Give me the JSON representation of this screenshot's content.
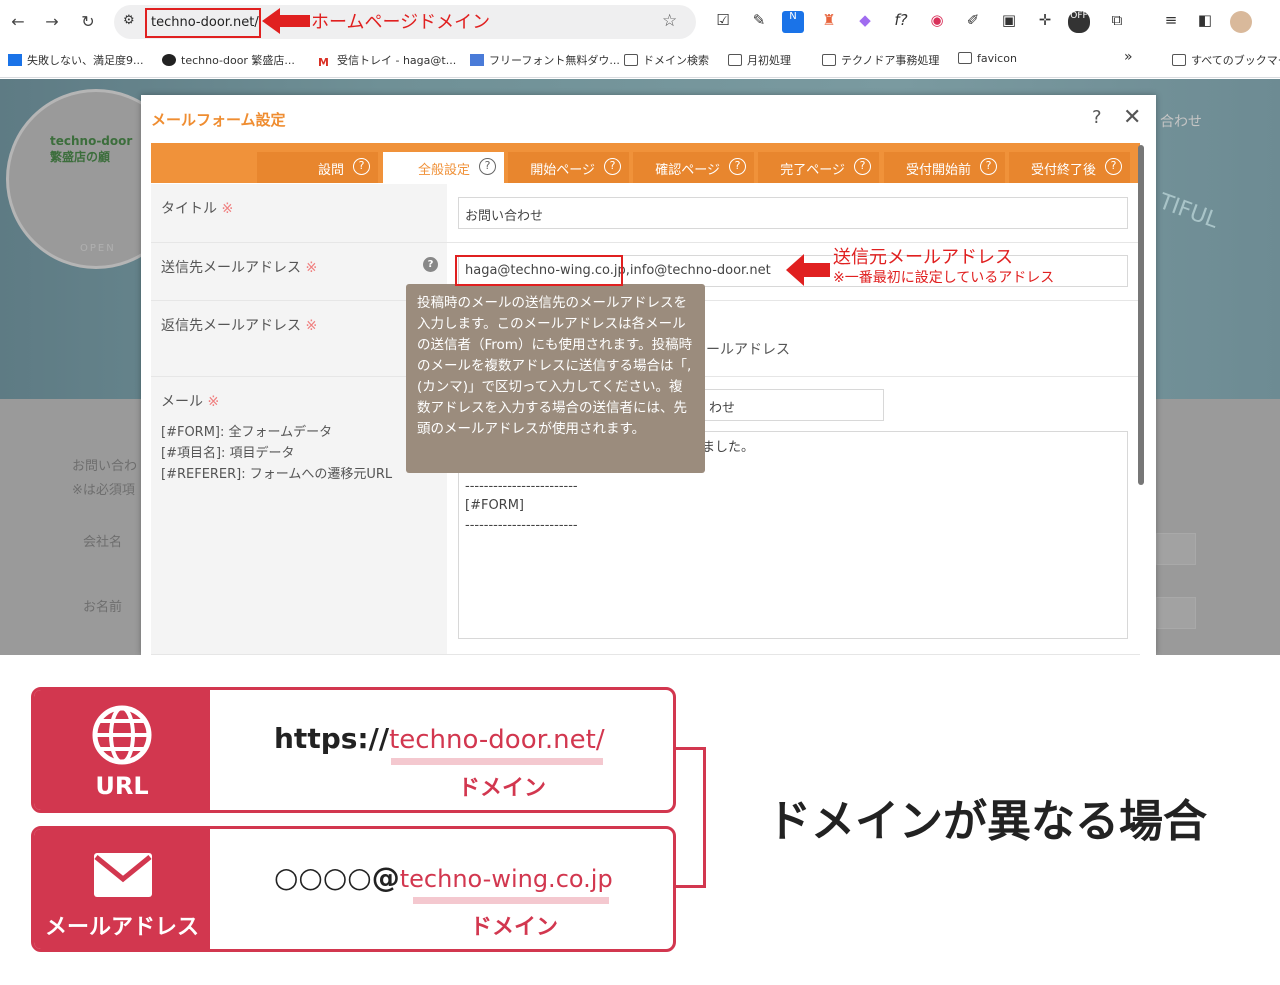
{
  "browser": {
    "url": "techno-door.net/co",
    "url_callout": "ホームページドメイン",
    "bookmarks": [
      "失敗しない、満足度9...",
      "techno-door 繁盛店...",
      "受信トレイ - haga@t...",
      "フリーフォント無料ダウ...",
      "ドメイン検索",
      "月初処理",
      "テクノドア事務処理",
      "favicon",
      "すべてのブックマーク"
    ],
    "more": "»"
  },
  "background": {
    "logo_line1": "techno-door",
    "logo_line2": "繁盛店の顧",
    "open_text": "OPEN",
    "contact_nav": "合わせ",
    "hero_text": "TIFUL",
    "form_intro": "お問い合わ",
    "required_note": "※は必須項",
    "company": "会社名",
    "name": "お名前"
  },
  "dialog": {
    "title": "メールフォーム設定",
    "help": "?",
    "close": "✕",
    "tabs": [
      {
        "label": "設問",
        "active": false
      },
      {
        "label": "全般設定",
        "active": true
      },
      {
        "label": "開始ページ",
        "active": false
      },
      {
        "label": "確認ページ",
        "active": false
      },
      {
        "label": "完了ページ",
        "active": false
      },
      {
        "label": "受付開始前",
        "active": false
      },
      {
        "label": "受付終了後",
        "active": false
      }
    ],
    "tab_q": "?",
    "rows": {
      "title_label": "タイトル",
      "title_value": "お問い合わせ",
      "sender_label": "送信先メールアドレス",
      "sender_value": "haga@techno-wing.co.jp,info@techno-door.net",
      "reply_label": "返信先メールアドレス",
      "reply_partial": "ールアドレス",
      "mail_label": "メール",
      "mail_help1": "[#FORM]: 全フォームデータ",
      "mail_help2": "[#項目名]: 項目データ",
      "mail_help3": "[#REFERER]: フォームへの遷移元URL",
      "mail_subject_partial": "わせ",
      "mail_body_partial": "ました。",
      "mail_body_line1": "------------------------",
      "mail_body_line2": "[#FORM]",
      "mail_body_line3": "------------------------"
    },
    "required_mark": "※",
    "tooltip": "投稿時のメールの送信先のメールアドレスを入力します。このメールアドレスは各メールの送信者（From）にも使用されます。投稿時のメールを複数アドレスに送信する場合は「,(カンマ)」で区切って入力してください。複数アドレスを入力する場合の送信者には、先頭のメールアドレスが使用されます。",
    "sender_callout": "送信元メールアドレス",
    "sender_callout_sub": "※一番最初に設定しているアドレス"
  },
  "infographic": {
    "url_label": "URL",
    "url_prefix": "https://",
    "url_domain": "techno-door.net/",
    "domain_label": "ドメイン",
    "mail_label": "メールアドレス",
    "mail_prefix": "○○○○@",
    "mail_domain": "techno-wing.co.jp",
    "headline": "ドメインが異なる場合"
  },
  "colors": {
    "accent_orange": "#f0923a",
    "accent_red": "#d2374f",
    "callout_red": "#e02020",
    "tooltip_bg": "#9b8c7d"
  }
}
